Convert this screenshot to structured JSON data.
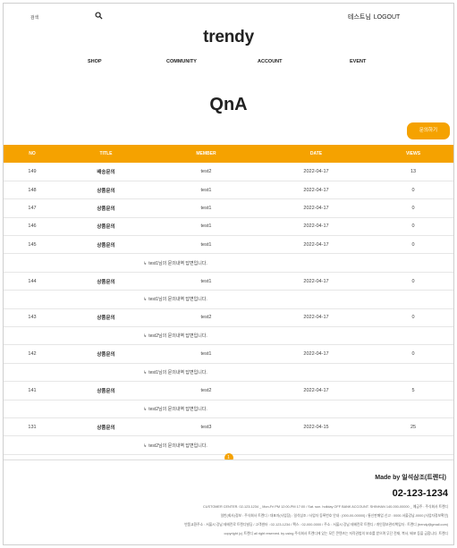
{
  "header": {
    "search_text": "검색",
    "user_name": "테스트님",
    "logout_label": "LOGOUT",
    "logo": "trendy"
  },
  "nav": [
    "SHOP",
    "COMMUNITY",
    "ACCOUNT",
    "EVENT"
  ],
  "page": {
    "title": "QnA",
    "write_button": "문의하기"
  },
  "table": {
    "columns": [
      "NO",
      "TITLE",
      "MEMBER",
      "DATE",
      "VIEWS"
    ],
    "rows": [
      {
        "type": "post",
        "no": "149",
        "title": "배송문의",
        "member": "test2",
        "date": "2022-04-17",
        "views": "13"
      },
      {
        "type": "post",
        "no": "148",
        "title": "상품문의",
        "member": "test1",
        "date": "2022-04-17",
        "views": "0"
      },
      {
        "type": "post",
        "no": "147",
        "title": "상품문의",
        "member": "test1",
        "date": "2022-04-17",
        "views": "0"
      },
      {
        "type": "post",
        "no": "146",
        "title": "상품문의",
        "member": "test1",
        "date": "2022-04-17",
        "views": "0"
      },
      {
        "type": "post",
        "no": "145",
        "title": "상품문의",
        "member": "test1",
        "date": "2022-04-17",
        "views": "0"
      },
      {
        "type": "reply",
        "text": "test1님의 문의내역 답변입니다."
      },
      {
        "type": "post",
        "no": "144",
        "title": "상품문의",
        "member": "test1",
        "date": "2022-04-17",
        "views": "0"
      },
      {
        "type": "reply",
        "text": "test1님의 문의내역 답변입니다."
      },
      {
        "type": "post",
        "no": "143",
        "title": "상품문의",
        "member": "test2",
        "date": "2022-04-17",
        "views": "0"
      },
      {
        "type": "reply",
        "text": "test2님의 문의내역 답변입니다."
      },
      {
        "type": "post",
        "no": "142",
        "title": "상품문의",
        "member": "test1",
        "date": "2022-04-17",
        "views": "0"
      },
      {
        "type": "reply",
        "text": "test1님의 문의내역 답변입니다."
      },
      {
        "type": "post",
        "no": "141",
        "title": "상품문의",
        "member": "test2",
        "date": "2022-04-17",
        "views": "5"
      },
      {
        "type": "reply",
        "text": "test2님의 문의내역 답변입니다."
      },
      {
        "type": "post",
        "no": "131",
        "title": "상품문의",
        "member": "test3",
        "date": "2022-04-15",
        "views": "25"
      },
      {
        "type": "reply",
        "text": "test2님의 문의내역 답변입니다."
      }
    ]
  },
  "pagination": {
    "current": "1"
  },
  "footer": {
    "made_by": "Made by 일석삼조(트렌디)",
    "phone": "02-123-1234",
    "info_lines": [
      "CUSTOMER CENTER. 02-123-1234 _ Mon-Fri PM 12:00-PM 17:00 / Sat. sun. holiday OFF BANK ACCOUNT. SHINHAN 140-000-00000 _ 예금주 : 주식회사 트렌디",
      "일반(회사)정보 : 주식회사 트렌디 / 대표자(사업장) : 일석삼조 / 사업자 등록번호 안내 : [000-00-00000] / 통신판매업 신고 : 0000-서울강남-0000 [사업자정보확인]",
      "반품교환주소 : 서울시 강남 테헤란로 트렌디빌딩 / 고객센터 : 02-123-1234 / 팩스 : 02-000-0000 / 주소 : 서울시 강남 테헤란로 트렌디 / 개인정보관리책임자 : 트렌디 (trendy@gmail.com)",
      "copyright (c) 트렌디 all right reserved. by using 주식회사 트렌디에 있는 모든 콘텐츠는 저작권법의 보호를 받으며 무단 전재, 복사, 배포 등을 금합니다. 트렌디"
    ]
  },
  "colors": {
    "accent": "#f5a200"
  }
}
